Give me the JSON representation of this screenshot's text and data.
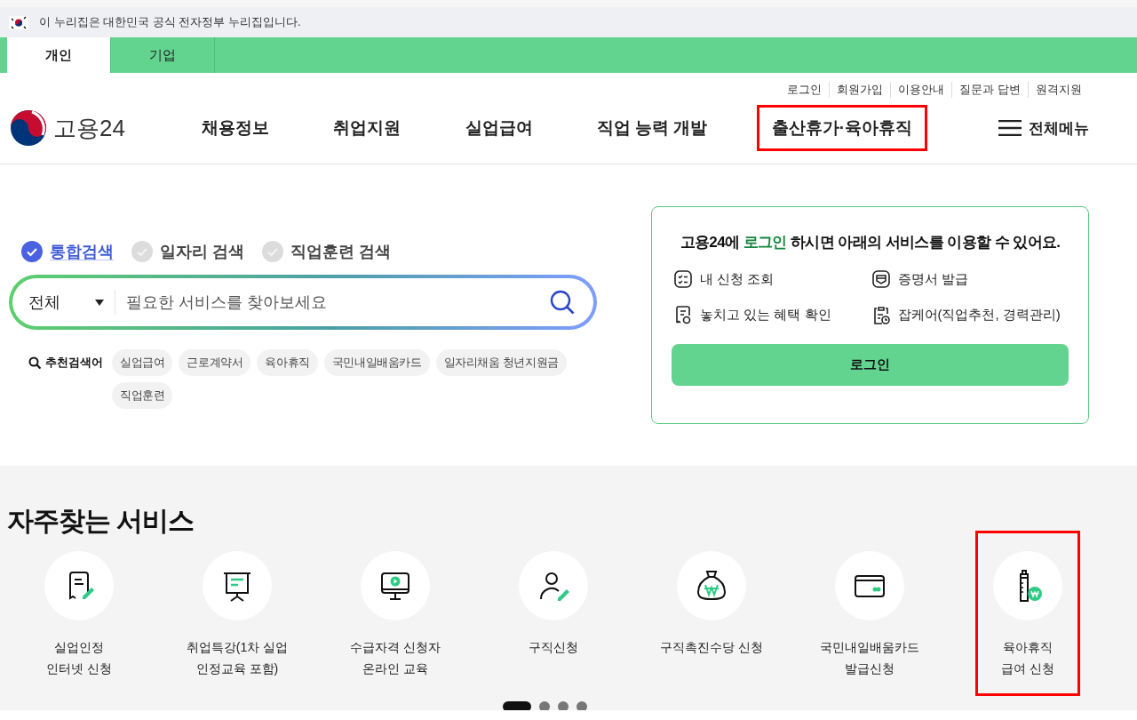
{
  "banner": {
    "text": "이 누리집은 대한민국 공식 전자정부 누리집입니다."
  },
  "user_tabs": [
    {
      "label": "개인",
      "selected": true
    },
    {
      "label": "기업",
      "selected": false
    }
  ],
  "utility_links": [
    "로그인",
    "회원가입",
    "이용안내",
    "질문과 답변",
    "원격지원"
  ],
  "logo": {
    "text": "고용24"
  },
  "nav": [
    {
      "label": "채용정보",
      "highlighted": false
    },
    {
      "label": "취업지원",
      "highlighted": false
    },
    {
      "label": "실업급여",
      "highlighted": false
    },
    {
      "label": "직업 능력 개발",
      "highlighted": false
    },
    {
      "label": "출산휴가·육아휴직",
      "highlighted": true
    }
  ],
  "all_menu": {
    "label": "전체메뉴"
  },
  "search": {
    "scopes": [
      {
        "label": "통합검색",
        "selected": true
      },
      {
        "label": "일자리 검색",
        "selected": false
      },
      {
        "label": "직업훈련 검색",
        "selected": false
      }
    ],
    "category": "전체",
    "placeholder": "필요한 서비스를 찾아보세요",
    "recommended_label": "추천검색어",
    "keywords": [
      "실업급여",
      "근로계약서",
      "육아휴직",
      "국민내일배움카드",
      "일자리채움 청년지원금",
      "직업훈련"
    ]
  },
  "login_card": {
    "title_before": "고용24에 ",
    "title_link": "로그인",
    "title_after": " 하시면 아래의 서비스를 이용할 수 있어요.",
    "features": [
      {
        "label": "내 신청 조회",
        "kind": "list"
      },
      {
        "label": "증명서 발급",
        "kind": "certificate"
      },
      {
        "label": "놓치고 있는 혜택 확인",
        "kind": "receipt"
      },
      {
        "label": "잡케어(직업추천, 경력관리)",
        "kind": "clipboard"
      }
    ],
    "button": "로그인"
  },
  "services": {
    "title": "자주찾는 서비스",
    "items": [
      {
        "lines": [
          "실업인정",
          "인터넷 신청"
        ],
        "kind": "document",
        "highlighted": false
      },
      {
        "lines": [
          "취업특강(1차 실업",
          "인정교육 포함)"
        ],
        "kind": "presentation",
        "highlighted": false
      },
      {
        "lines": [
          "수급자격 신청자",
          "온라인 교육"
        ],
        "kind": "monitor",
        "highlighted": false
      },
      {
        "lines": [
          "구직신청"
        ],
        "kind": "person",
        "highlighted": false
      },
      {
        "lines": [
          "구직촉진수당 신청"
        ],
        "kind": "moneybag",
        "highlighted": false
      },
      {
        "lines": [
          "국민내일배움카드",
          "발급신청"
        ],
        "kind": "card",
        "highlighted": false
      },
      {
        "lines": [
          "육아휴직",
          "급여 신청"
        ],
        "kind": "bottle",
        "highlighted": true
      }
    ],
    "pager": [
      {
        "selected": true
      },
      {
        "selected": false
      },
      {
        "selected": false
      },
      {
        "selected": false
      }
    ]
  }
}
